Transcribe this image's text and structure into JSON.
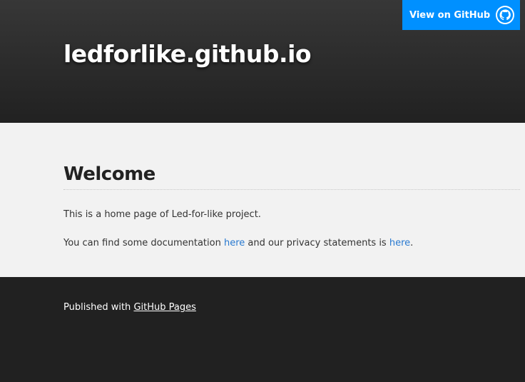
{
  "header": {
    "site_title": "ledforlike.github.io",
    "github_button_label": "View on GitHub"
  },
  "main": {
    "heading": "Welcome",
    "intro": "This is a home page of Led-for-like project.",
    "docs_prefix": "You can find some documentation ",
    "docs_link": "here",
    "docs_middle": " and our privacy statements is ",
    "privacy_link": "here",
    "docs_suffix": "."
  },
  "footer": {
    "prefix": "Published with ",
    "link": "GitHub Pages"
  },
  "colors": {
    "accent": "#0090ff",
    "link": "#2879d0",
    "header_bg": "#212121",
    "content_bg": "#f2f2f2"
  },
  "icons": [
    "github-icon"
  ]
}
